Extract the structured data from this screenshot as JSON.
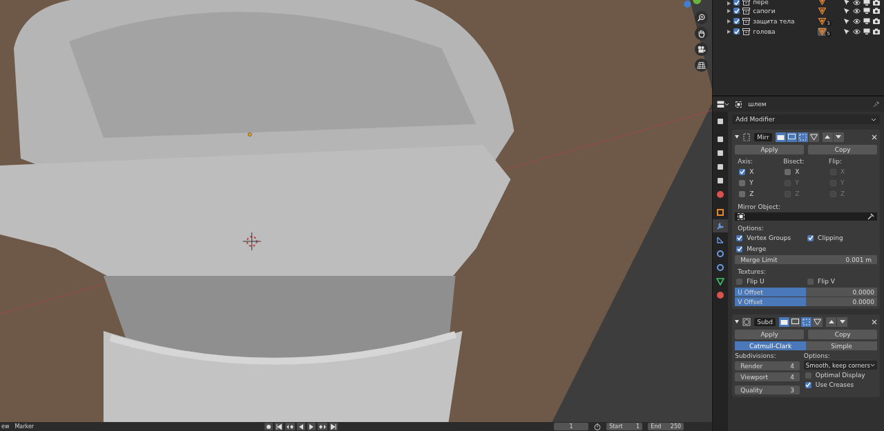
{
  "outliner": {
    "rows": [
      {
        "name": "пере",
        "checked": true
      },
      {
        "name": "сапоги",
        "checked": true
      },
      {
        "name": "защита тела",
        "checked": true,
        "badge": "3"
      },
      {
        "name": "голова",
        "checked": true,
        "badge": "5",
        "selected": true
      }
    ]
  },
  "gizmo": {
    "tools": [
      {
        "kind": "zoom"
      },
      {
        "kind": "pan"
      },
      {
        "kind": "camera"
      },
      {
        "kind": "grid"
      }
    ]
  },
  "properties": {
    "object_name": "шлем",
    "tabs": [
      {
        "kind": "tool",
        "selected": false
      },
      {
        "kind": "render",
        "selected": false
      },
      {
        "kind": "output",
        "selected": false
      },
      {
        "kind": "view_layer",
        "selected": false
      },
      {
        "kind": "scene",
        "selected": false
      },
      {
        "kind": "world",
        "selected": false
      },
      {
        "kind": "object",
        "selected": false
      },
      {
        "kind": "modifier",
        "selected": true
      },
      {
        "kind": "particles",
        "selected": false
      },
      {
        "kind": "physics",
        "selected": false
      },
      {
        "kind": "constraints",
        "selected": false
      },
      {
        "kind": "data",
        "selected": false
      },
      {
        "kind": "material",
        "selected": false
      }
    ],
    "add_modifier": "Add Modifier",
    "mirror": {
      "name": "Mirr",
      "toggles": [
        {
          "kind": "render",
          "on": true
        },
        {
          "kind": "realtime",
          "on": true
        },
        {
          "kind": "editmode",
          "on": true
        },
        {
          "kind": "cage",
          "on": false
        }
      ],
      "apply": "Apply",
      "copy": "Copy",
      "axis": {
        "label": "Axis:",
        "items": [
          {
            "label": "X",
            "checked": true,
            "disabled": false
          },
          {
            "label": "Y",
            "checked": false,
            "disabled": false
          },
          {
            "label": "Z",
            "checked": false,
            "disabled": false
          }
        ]
      },
      "bisect": {
        "label": "Bisect:",
        "items": [
          {
            "label": "X",
            "checked": false,
            "disabled": false
          },
          {
            "label": "Y",
            "checked": false,
            "disabled": true
          },
          {
            "label": "Z",
            "checked": false,
            "disabled": true
          }
        ]
      },
      "flip": {
        "label": "Flip:",
        "items": [
          {
            "label": "X",
            "checked": false,
            "disabled": true
          },
          {
            "label": "Y",
            "checked": false,
            "disabled": true
          },
          {
            "label": "Z",
            "checked": false,
            "disabled": true
          }
        ]
      },
      "mirror_object_label": "Mirror Object:",
      "options_label": "Options:",
      "options": [
        {
          "label": "Vertex Groups",
          "checked": true
        },
        {
          "label": "Clipping",
          "checked": true
        },
        {
          "label": "Merge",
          "checked": true
        }
      ],
      "merge_limit": {
        "label": "Merge Limit",
        "value": "0.001 m"
      },
      "textures_label": "Textures:",
      "flips": [
        {
          "label": "Flip U",
          "checked": false
        },
        {
          "label": "Flip V",
          "checked": false
        }
      ],
      "offsets": [
        {
          "label": "U Offset",
          "value": "0.0000",
          "level": 0.5
        },
        {
          "label": "V Offset",
          "value": "0.0000",
          "level": 0.5
        }
      ]
    },
    "subsurf": {
      "name": "Subd",
      "toggles": [
        {
          "kind": "render",
          "on": true
        },
        {
          "kind": "realtime",
          "on": false
        },
        {
          "kind": "editmode",
          "on": true
        },
        {
          "kind": "cage",
          "on": false
        }
      ],
      "apply": "Apply",
      "copy": "Copy",
      "types": [
        {
          "label": "Catmull-Clark",
          "selected": true
        },
        {
          "label": "Simple",
          "selected": false
        }
      ],
      "subdivisions_label": "Subdivisions:",
      "levels": [
        {
          "label": "Render",
          "value": "4"
        },
        {
          "label": "Viewport",
          "value": "4"
        },
        {
          "label": "Quality",
          "value": "3"
        }
      ],
      "options_label": "Options:",
      "uv_smooth": "Smooth, keep corners",
      "checks": [
        {
          "label": "Optimal Display",
          "checked": false
        },
        {
          "label": "Use Creases",
          "checked": true
        }
      ]
    }
  },
  "timeline": {
    "menus": [
      "ew",
      "Marker"
    ],
    "frame": "1",
    "start": {
      "label": "Start",
      "value": "1"
    },
    "end": {
      "label": "End",
      "value": "250"
    }
  }
}
